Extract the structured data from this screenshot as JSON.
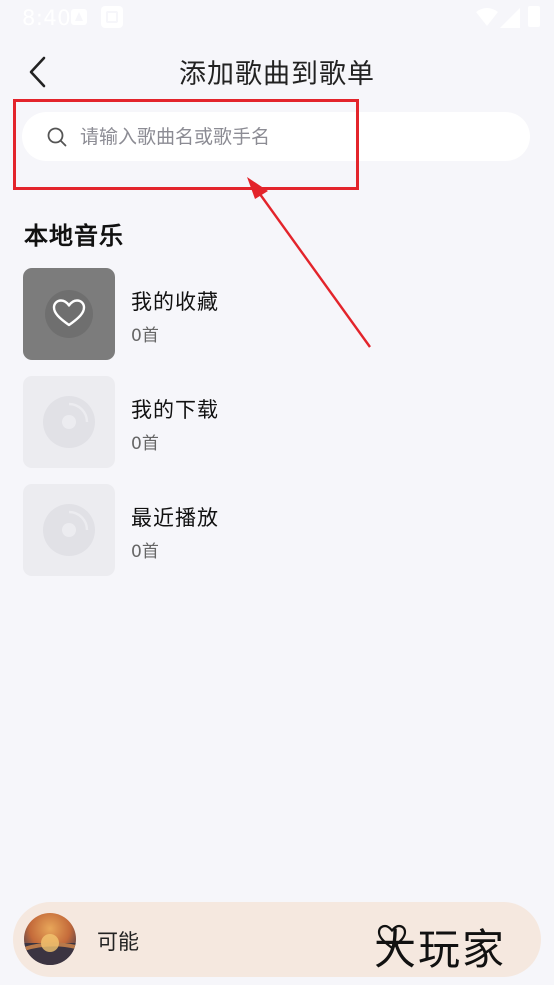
{
  "status_bar": {
    "time": "8:40"
  },
  "header": {
    "title": "添加歌曲到歌单"
  },
  "search": {
    "placeholder": "请输入歌曲名或歌手名",
    "value": ""
  },
  "section": {
    "title": "本地音乐"
  },
  "playlists": [
    {
      "name": "我的收藏",
      "count": "0首",
      "icon": "heart-icon"
    },
    {
      "name": "我的下载",
      "count": "0首",
      "icon": "disc-icon"
    },
    {
      "name": "最近播放",
      "count": "0首",
      "icon": "disc-icon"
    }
  ],
  "player": {
    "title": "可能"
  },
  "watermark": {
    "text": "大玩家"
  },
  "colors": {
    "background": "#f6f6fa",
    "annotation": "#e3242b",
    "player_bg": "#f5e8df"
  }
}
